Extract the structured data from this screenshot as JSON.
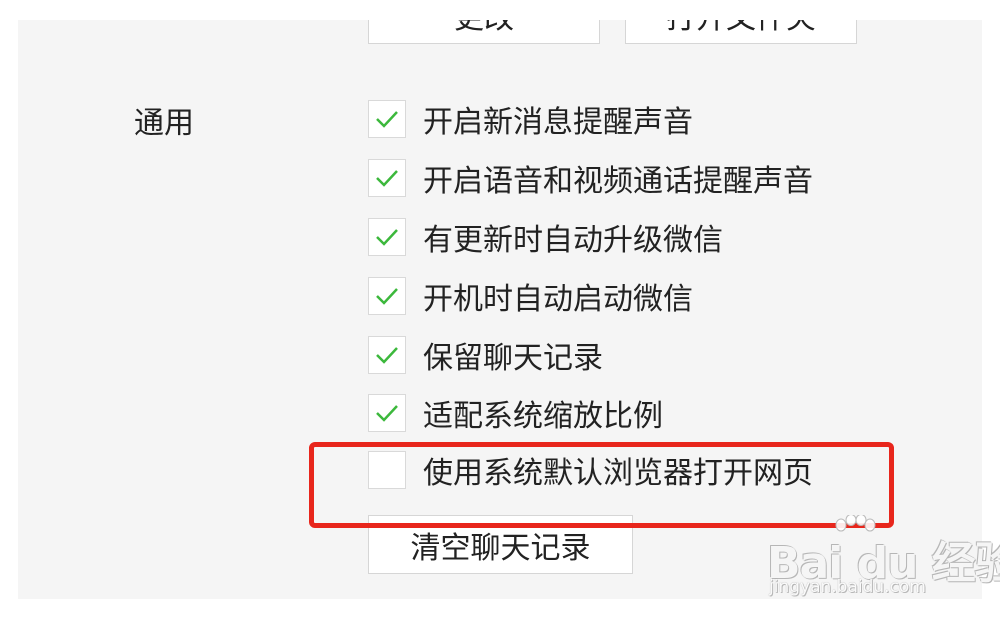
{
  "top_buttons": {
    "change_label": "更改",
    "open_folder_label": "打开文件夹"
  },
  "general": {
    "section_label": "通用",
    "options": [
      {
        "label": "开启新消息提醒声音",
        "checked": true
      },
      {
        "label": "开启语音和视频通话提醒声音",
        "checked": true
      },
      {
        "label": "有更新时自动升级微信",
        "checked": true
      },
      {
        "label": "开机时自动启动微信",
        "checked": true
      },
      {
        "label": "保留聊天记录",
        "checked": true
      },
      {
        "label": "适配系统缩放比例",
        "checked": true
      },
      {
        "label": "使用系统默认浏览器打开网页",
        "checked": false
      }
    ],
    "clear_history_label": "清空聊天记录"
  },
  "colors": {
    "check_mark": "#3cb83c",
    "highlight_border": "#e8261c",
    "panel_background": "#f5f5f5"
  },
  "watermark": {
    "brand": "Bai du 经验",
    "url": "jingyan.baidu.com"
  }
}
